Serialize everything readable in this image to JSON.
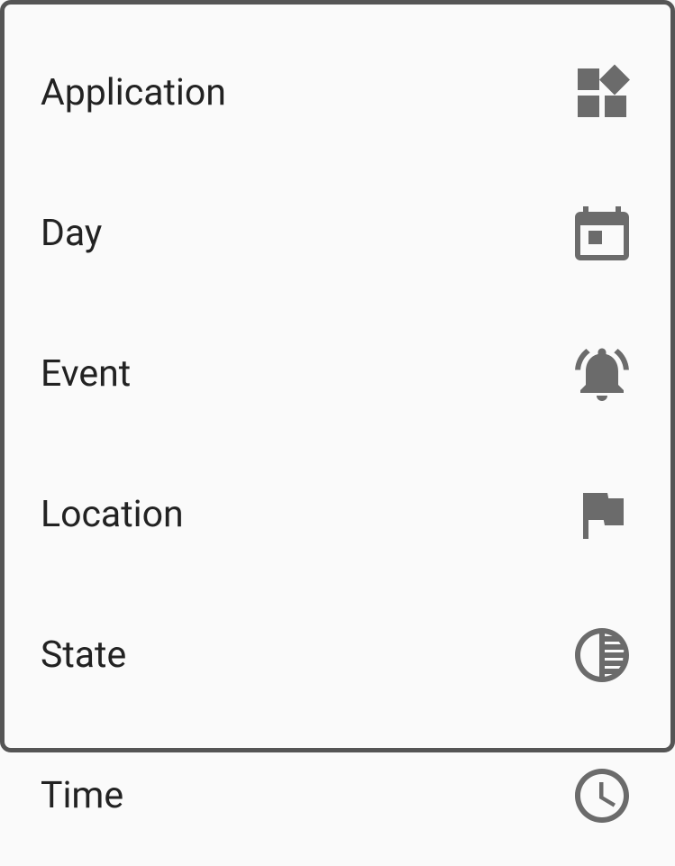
{
  "menu": {
    "items": [
      {
        "label": "Application",
        "icon": "widgets-icon"
      },
      {
        "label": "Day",
        "icon": "calendar-icon"
      },
      {
        "label": "Event",
        "icon": "bell-icon"
      },
      {
        "label": "Location",
        "icon": "flag-icon"
      },
      {
        "label": "State",
        "icon": "tonality-icon"
      },
      {
        "label": "Time",
        "icon": "clock-icon"
      }
    ]
  }
}
